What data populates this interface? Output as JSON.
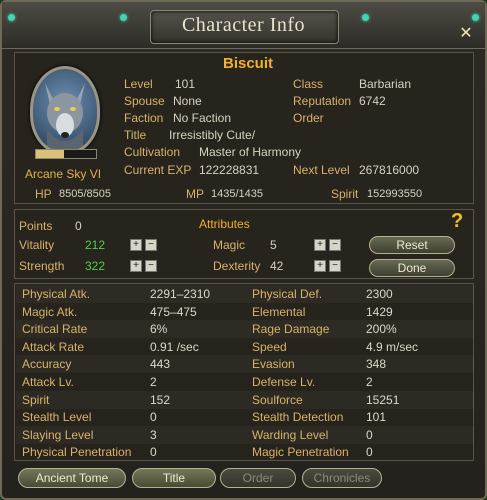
{
  "window": {
    "title": "Character Info",
    "close_icon": "✕"
  },
  "character": {
    "name": "Biscuit",
    "server": "Arcane Sky VI",
    "exp_fraction": 0.46
  },
  "info": {
    "level_label": "Level",
    "level": "101",
    "spouse_label": "Spouse",
    "spouse": "None",
    "faction_label": "Faction",
    "faction": "No Faction",
    "title_label": "Title",
    "title": "Irresistibly Cute/",
    "cultivation_label": "Cultivation",
    "cultivation": "Master of Harmony",
    "exp_label": "Current EXP",
    "exp": "122228831",
    "class_label": "Class",
    "class": "Barbarian",
    "reputation_label": "Reputation",
    "reputation": "6742",
    "order_label": "Order",
    "next_label": "Next Level",
    "next": "267816000"
  },
  "vitals": {
    "hp_label": "HP",
    "hp": "8505/8505",
    "mp_label": "MP",
    "mp": "1435/1435",
    "spirit_label": "Spirit",
    "spirit": "152993550"
  },
  "attributes": {
    "heading": "Attributes",
    "points_label": "Points",
    "points": "0",
    "vitality_label": "Vitality",
    "vitality": "212",
    "strength_label": "Strength",
    "strength": "322",
    "magic_label": "Magic",
    "magic": "5",
    "dexterity_label": "Dexterity",
    "dexterity": "42",
    "reset_label": "Reset",
    "done_label": "Done",
    "help_icon": "?"
  },
  "stats": [
    {
      "l1": "Physical Atk.",
      "v1": "2291–2310",
      "l2": "Physical Def.",
      "v2": "2300"
    },
    {
      "l1": "Magic Atk.",
      "v1": "475–475",
      "l2": "Elemental",
      "v2": "1429"
    },
    {
      "l1": "Critical Rate",
      "v1": "6%",
      "l2": "Rage Damage",
      "v2": "200%"
    },
    {
      "l1": "Attack Rate",
      "v1": "0.91 /sec",
      "l2": "Speed",
      "v2": "4.9 m/sec"
    },
    {
      "l1": "Accuracy",
      "v1": "443",
      "l2": "Evasion",
      "v2": "348"
    },
    {
      "l1": "Attack Lv.",
      "v1": "2",
      "l2": "Defense Lv.",
      "v2": "2"
    },
    {
      "l1": "Spirit",
      "v1": "152",
      "l2": "Soulforce",
      "v2": "15251"
    },
    {
      "l1": "Stealth Level",
      "v1": "0",
      "l2": "Stealth Detection",
      "v2": "101"
    },
    {
      "l1": "Slaying Level",
      "v1": "3",
      "l2": "Warding Level",
      "v2": "0"
    },
    {
      "l1": "Physical Penetration",
      "v1": "0",
      "l2": "Magic Penetration",
      "v2": "0"
    }
  ],
  "tabs": [
    "Ancient Tome",
    "Title",
    "Order",
    "Chronicles"
  ]
}
